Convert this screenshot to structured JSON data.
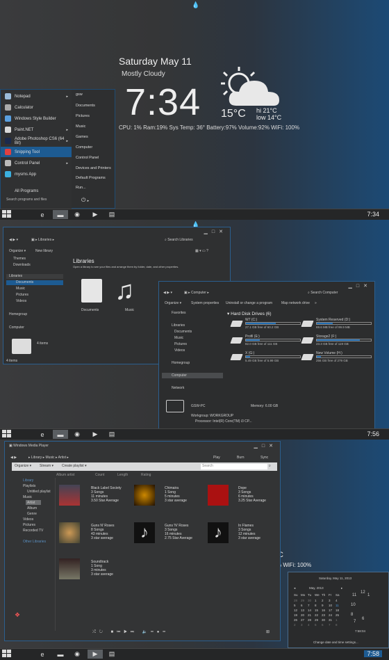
{
  "screen1": {
    "date": "Saturday May 11",
    "condition": "Mostly Cloudy",
    "time": "7:34",
    "temp": "15°C",
    "hi": "hi 21°C",
    "lo": "low 14°C",
    "stats": "CPU: 1%   Ram:19%  Sys Temp: 36°  Battery:97%  Volume:92%   WiFi: 100%",
    "clock": "7:34",
    "start_menu": {
      "left_items": [
        "Notepad",
        "Calculator",
        "Windows Style Builder",
        "Paint.NET",
        "Adobe Photoshop CS6 (64 Bit)",
        "Snipping Tool",
        "Control Panel",
        "mysms App"
      ],
      "all_programs": "All Programs",
      "search": "Search programs and files",
      "right_items": [
        "gsw",
        "Documents",
        "Pictures",
        "Music",
        "Games",
        "Computer",
        "Control Panel",
        "Devices and Printers",
        "Default Programs",
        "Run..."
      ]
    }
  },
  "screen2": {
    "clock": "7:56",
    "libraries": {
      "address": "Libraries",
      "search": "Search Libraries",
      "toolbar": [
        "Organize ▾",
        "New library"
      ],
      "nav": [
        "Themes",
        "Downloads",
        "Libraries",
        "Documents",
        "Music",
        "Pictures",
        "Videos",
        "Homegroup",
        "Computer"
      ],
      "title": "Libraries",
      "subtitle": "Open a library to see your files and arrange them by folder, date, and other properties.",
      "items": [
        "Documents",
        "Music"
      ],
      "count": "4 items",
      "status": "4 items"
    },
    "computer": {
      "address": "Computer",
      "search": "Search Computer",
      "toolbar": [
        "Organize ▾",
        "System properties",
        "Uninstall or change a program",
        "Map network drive",
        "»"
      ],
      "nav": [
        "Favorites",
        "Libraries",
        "Documents",
        "Music",
        "Pictures",
        "Videos",
        "Homegroup",
        "Computer",
        "Network"
      ],
      "section": "Hard Disk Drives (6)",
      "drives": [
        {
          "name": "W7 (C:)",
          "free": "27.1 GB free of 60.2 GB",
          "fill": 0.55
        },
        {
          "name": "System Reserved (D:)",
          "free": "69.6 MB free of 99.9 MB",
          "fill": 0.3
        },
        {
          "name": "Profil (E:)",
          "free": "82.0 GB free of 111 GB",
          "fill": 0.26
        },
        {
          "name": "Storage2 (F:)",
          "free": "23.3 GB free of 119 GB",
          "fill": 0.8
        },
        {
          "name": "X (G:)",
          "free": "5.49 GB free of 5.99 GB",
          "fill": 0.08
        },
        {
          "name": "New Volume (H:)",
          "free": "256 GB free of 279 GB",
          "fill": 0.08
        }
      ],
      "pc_name": "GSW-PC",
      "workgroup": "Workgroup: WORKGROUP",
      "memory": "Memory: 6.00 GB",
      "processor": "Processor: Intel(R) Core(TM) i3 CP..."
    }
  },
  "screen3": {
    "clock": "7:58",
    "wmp": {
      "title": "Windows Media Player",
      "breadcrumb": [
        "Library",
        "Music",
        "Artist"
      ],
      "tabs": [
        "Play",
        "Burn",
        "Sync"
      ],
      "search": "Search",
      "toolbar": [
        "Organize ▾",
        "Stream ▾",
        "Create playlist ▾"
      ],
      "columns": [
        "Album artist",
        "Count",
        "Length",
        "Rating"
      ],
      "nav": [
        "Library",
        "Playlists",
        "Untitled playlist",
        "Music",
        "Artist",
        "Album",
        "Genre",
        "Videos",
        "Pictures",
        "Recorded TV",
        "Other Libraries"
      ],
      "albums": [
        {
          "name": "Black Label Society",
          "l1": "3 Songs",
          "l2": "11 minutes",
          "l3": "3.50 Star Average"
        },
        {
          "name": "Chimaira",
          "l1": "1 Song",
          "l2": "5 minutes",
          "l3": "3 star average"
        },
        {
          "name": "Dope",
          "l1": "3 Songs",
          "l2": "6 minutes",
          "l3": "3.25 Star Average"
        },
        {
          "name": "Guns N' Roses",
          "l1": "8 Songs",
          "l2": "43 minutes",
          "l3": "3 star average"
        },
        {
          "name": "Guns 'N' Roses",
          "l1": "3 Songs",
          "l2": "16 minutes",
          "l3": "2.75 Star Average"
        },
        {
          "name": "In Flames",
          "l1": "3 Songs",
          "l2": "12 minutes",
          "l3": "3 star average"
        },
        {
          "name": "Soundtrack",
          "l1": "1 Song",
          "l2": "3 minutes",
          "l3": "3 star average"
        }
      ]
    },
    "peek_c": "C",
    "peek_wifi": "% WiFi: 100%",
    "calendar": {
      "header": "Saturday, May 11, 2013",
      "month": "May, 2013",
      "days": [
        "Su",
        "Mo",
        "Tu",
        "We",
        "Th",
        "Fr",
        "Sa"
      ],
      "rows": [
        [
          "28",
          "29",
          "30",
          "1",
          "2",
          "3",
          "4"
        ],
        [
          "5",
          "6",
          "7",
          "8",
          "9",
          "10",
          "11"
        ],
        [
          "12",
          "13",
          "14",
          "15",
          "16",
          "17",
          "18"
        ],
        [
          "19",
          "20",
          "21",
          "22",
          "23",
          "24",
          "25"
        ],
        [
          "26",
          "27",
          "28",
          "29",
          "30",
          "31",
          "1"
        ],
        [
          "2",
          "3",
          "4",
          "5",
          "6",
          "7",
          "8"
        ]
      ],
      "time": "7:58:04",
      "link": "Change date and time settings..."
    }
  }
}
